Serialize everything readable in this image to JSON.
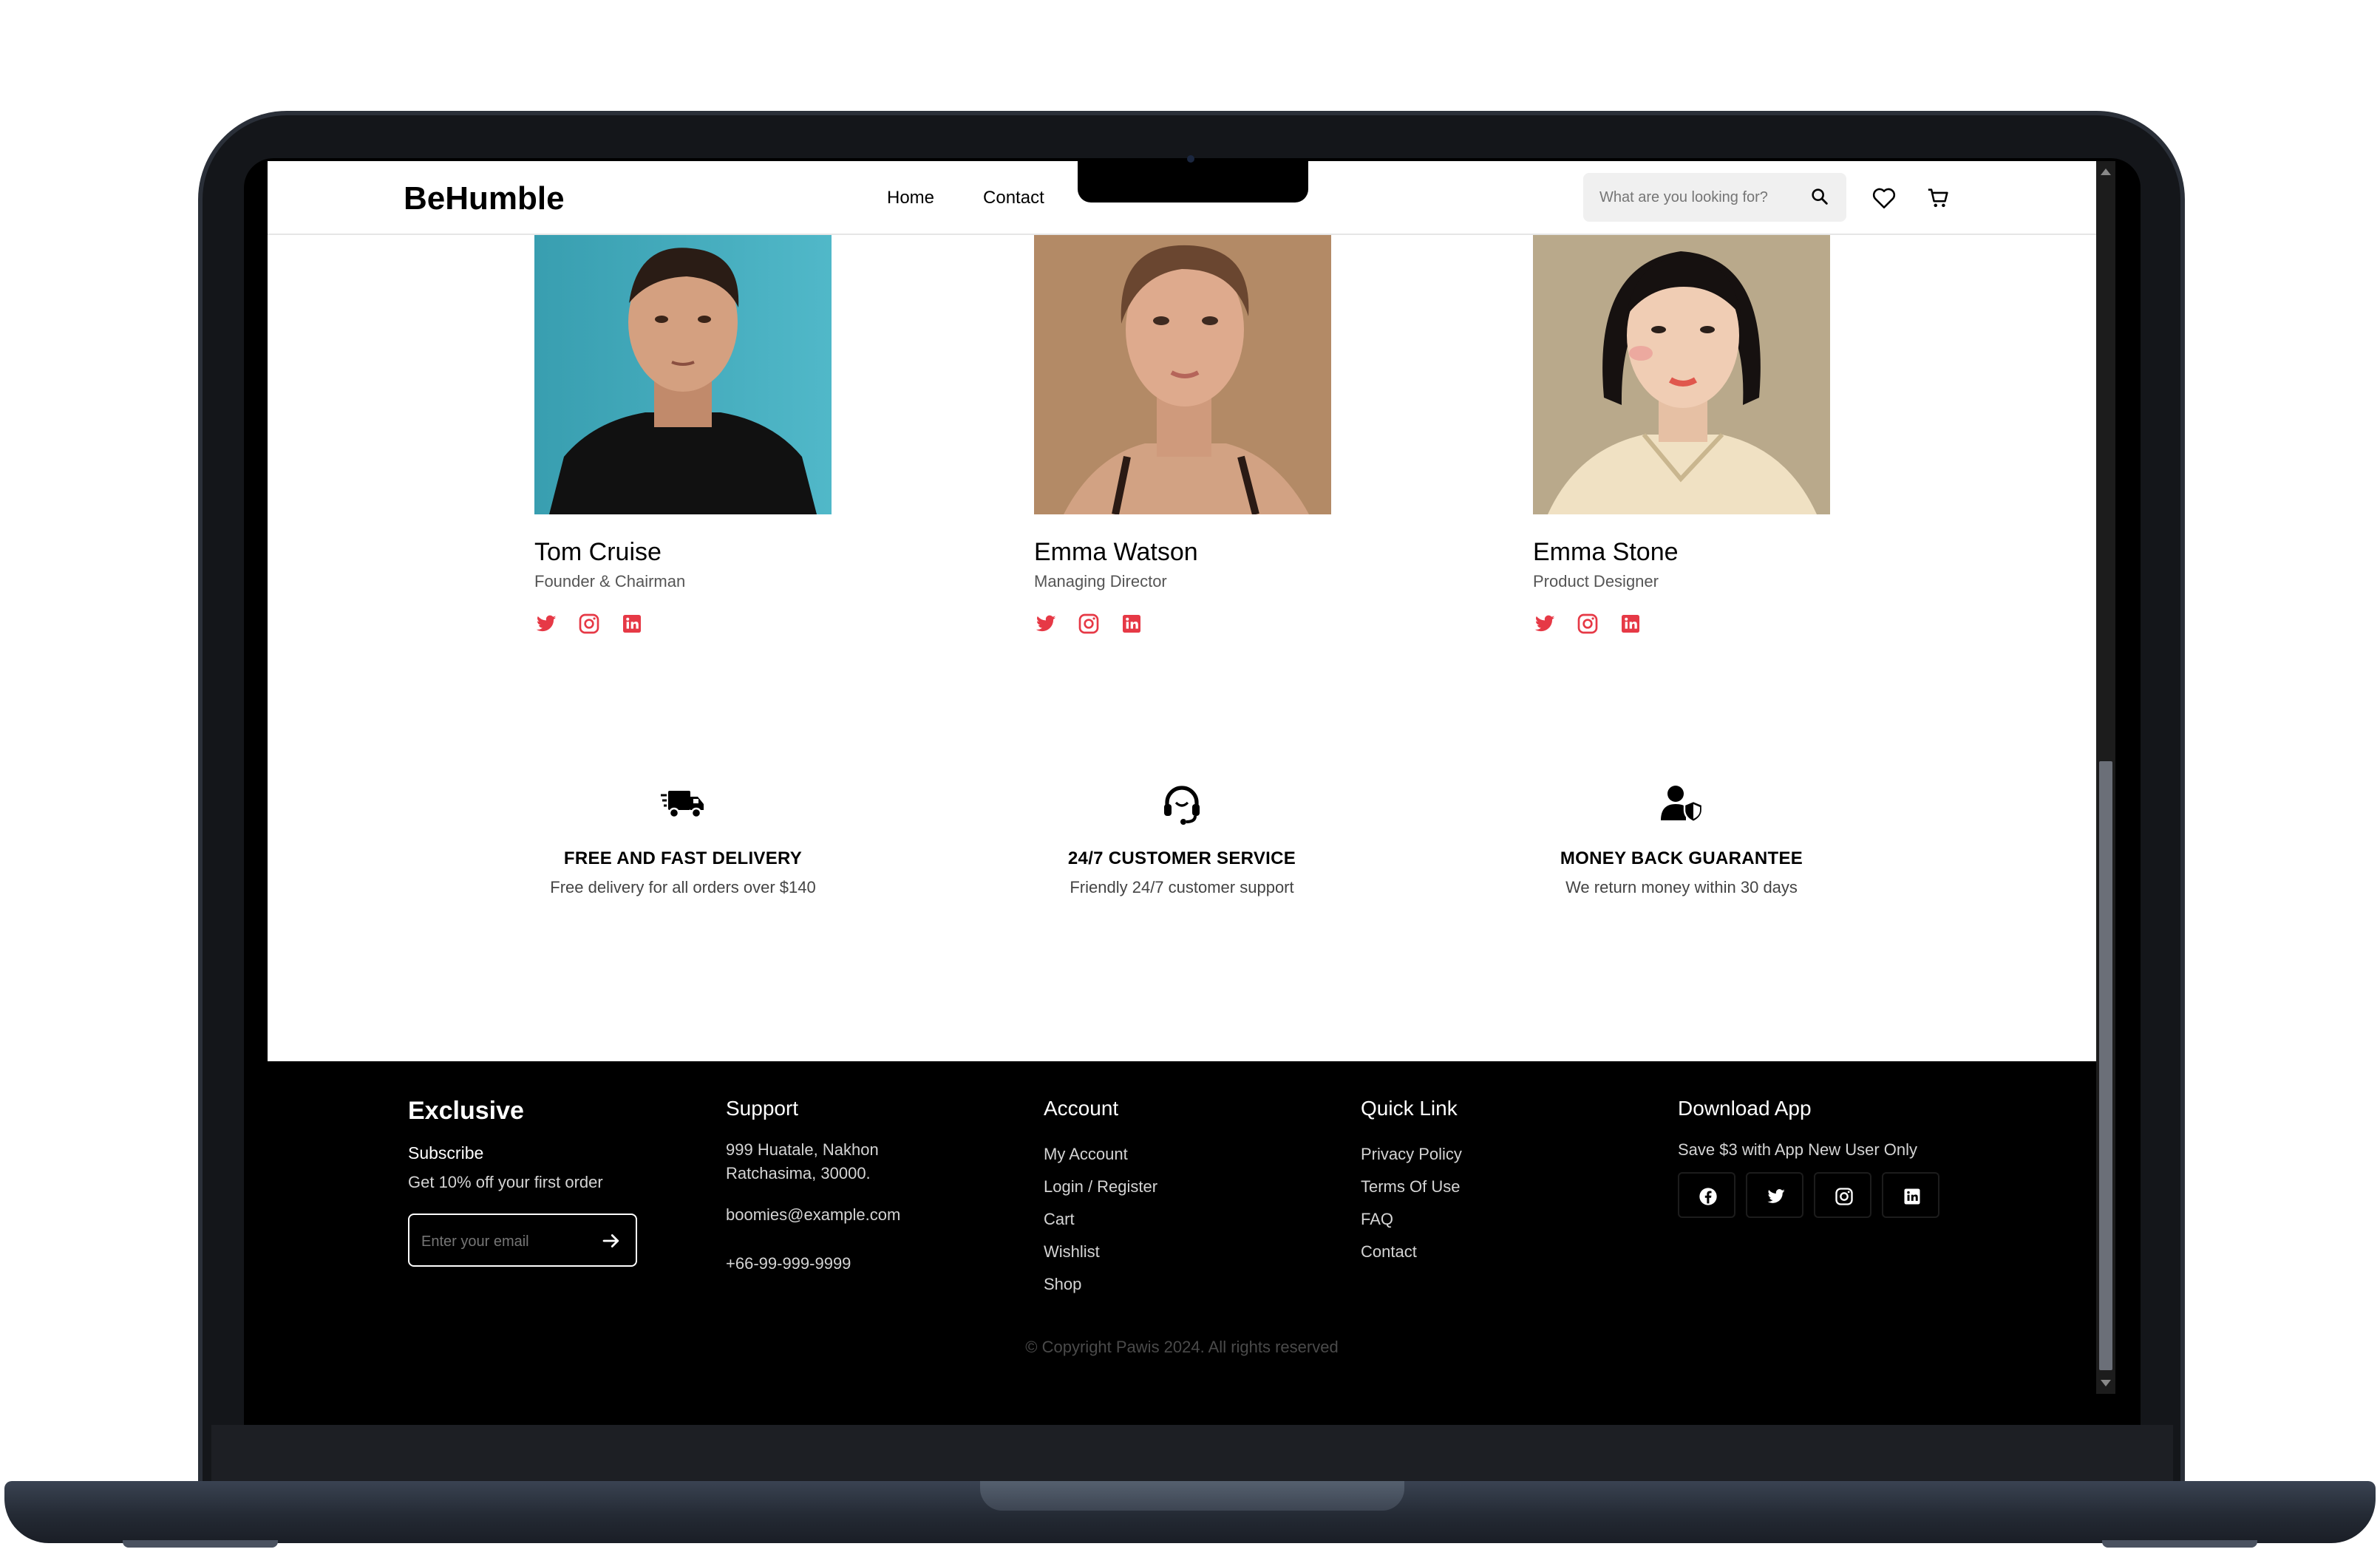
{
  "header": {
    "logo": "BeHumble",
    "nav": [
      "Home",
      "Contact"
    ],
    "search_placeholder": "What are you looking for?"
  },
  "team": [
    {
      "name": "Tom Cruise",
      "role": "Founder & Chairman"
    },
    {
      "name": "Emma Watson",
      "role": "Managing Director"
    },
    {
      "name": "Emma Stone",
      "role": "Product Designer"
    }
  ],
  "features": [
    {
      "title": "FREE AND FAST DELIVERY",
      "desc": "Free delivery for all orders over $140",
      "icon": "delivery-truck-icon"
    },
    {
      "title": "24/7 CUSTOMER SERVICE",
      "desc": "Friendly 24/7 customer support",
      "icon": "headset-icon"
    },
    {
      "title": "MONEY BACK GUARANTEE",
      "desc": "We return money within 30 days",
      "icon": "user-shield-icon"
    }
  ],
  "footer": {
    "brand": "Exclusive",
    "subscribe": "Subscribe",
    "offer": "Get 10% off your first order",
    "email_placeholder": "Enter your email",
    "support": {
      "title": "Support",
      "address_1": "999 Huatale, Nakhon",
      "address_2": "Ratchasima, 30000.",
      "email": "boomies@example.com",
      "phone": "+66-99-999-9999"
    },
    "account": {
      "title": "Account",
      "links": [
        "My Account",
        "Login / Register",
        "Cart",
        "Wishlist",
        "Shop"
      ]
    },
    "quick_link": {
      "title": "Quick Link",
      "links": [
        "Privacy Policy",
        "Terms Of Use",
        "FAQ",
        "Contact"
      ]
    },
    "download": {
      "title": "Download App",
      "note": "Save $3 with App New User Only"
    },
    "copyright": "© Copyright Pawis 2024. All rights reserved"
  },
  "colors": {
    "accent": "#e63946",
    "footer_bg": "#000000"
  }
}
